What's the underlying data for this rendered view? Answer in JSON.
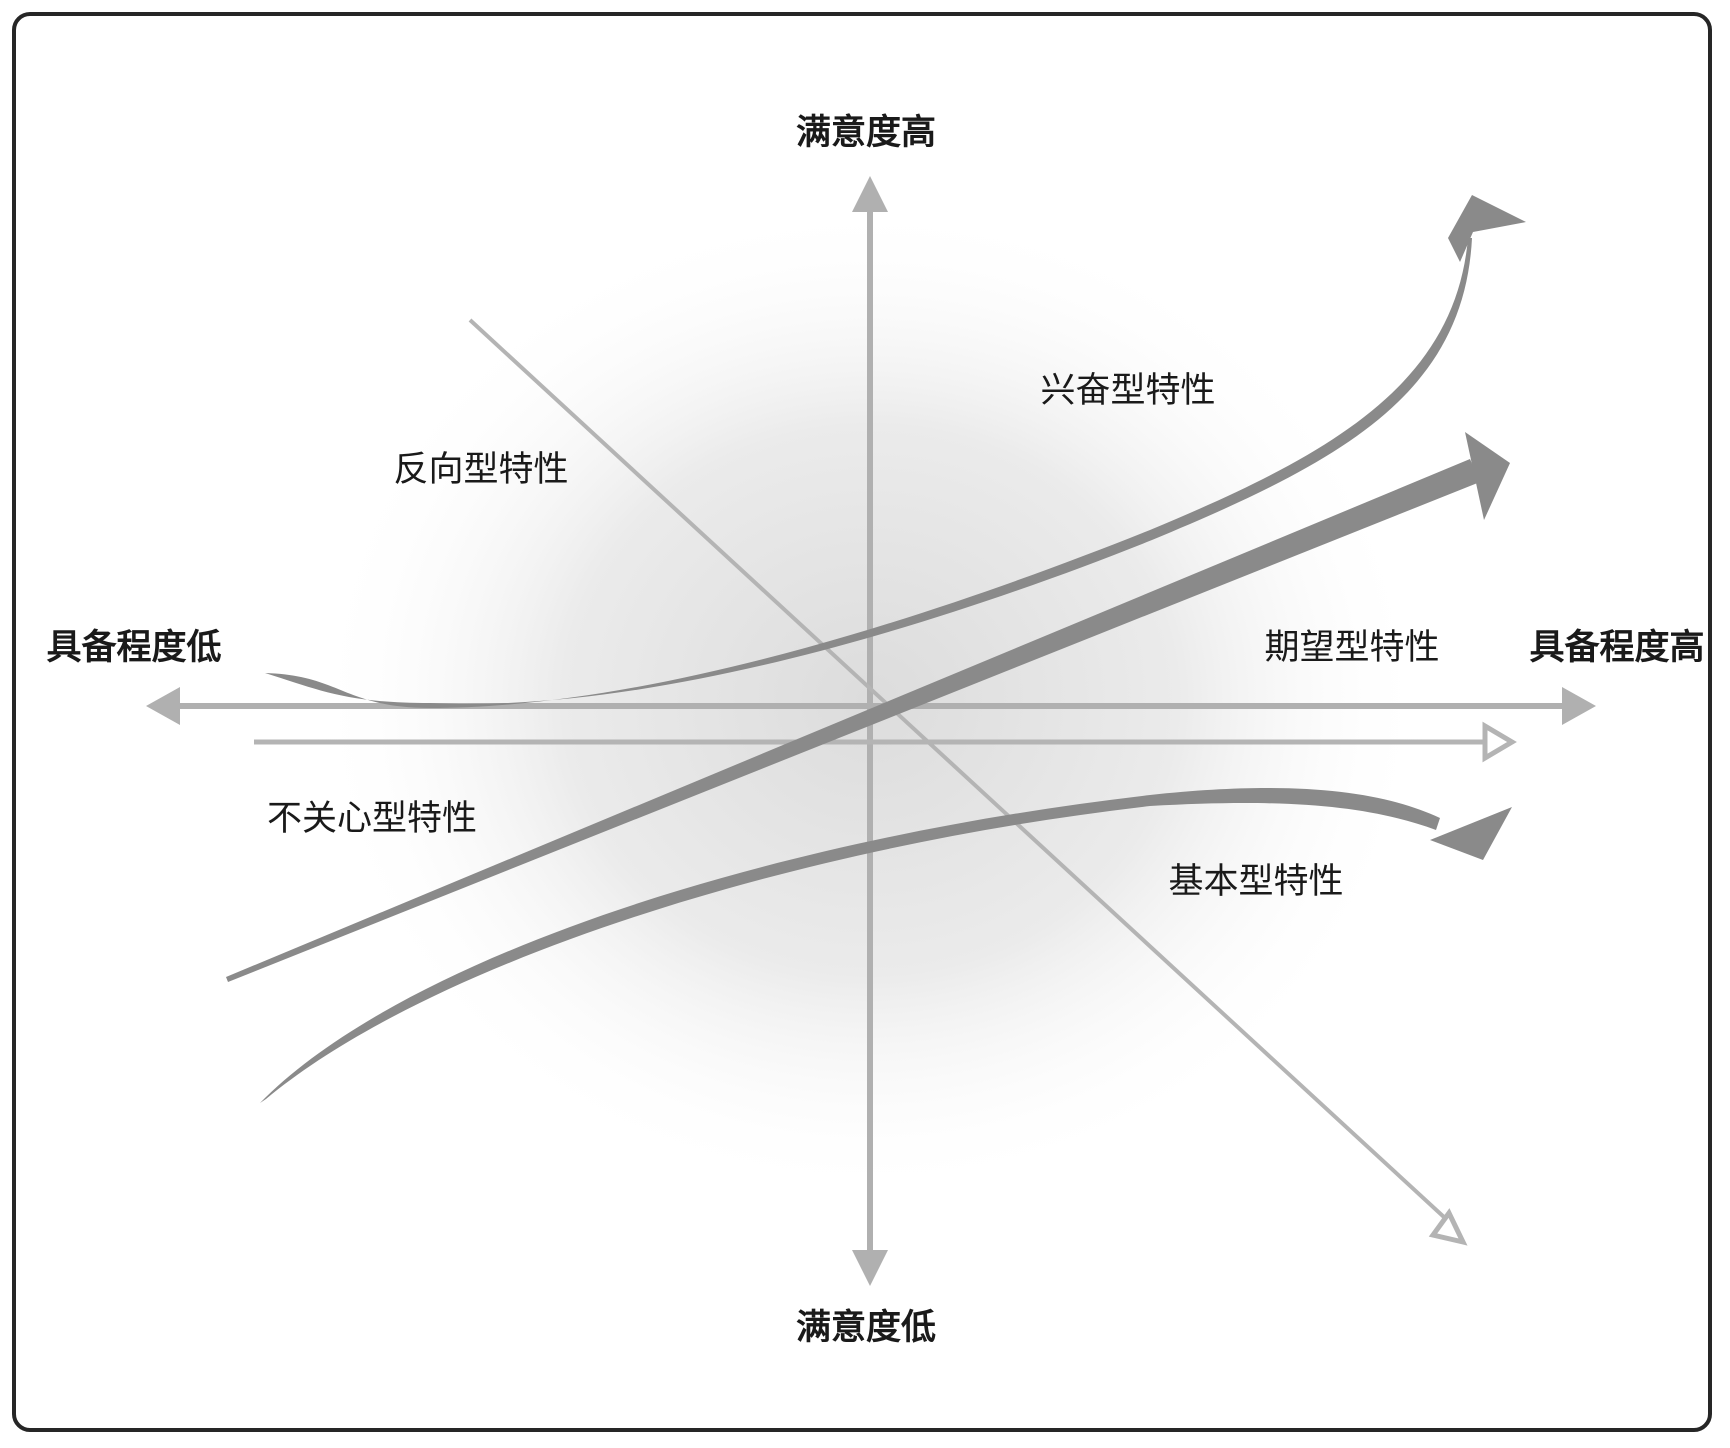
{
  "axes": {
    "satisfaction_high": "满意度高",
    "satisfaction_low": "满意度低",
    "fulfillment_low": "具备程度低",
    "fulfillment_high": "具备程度高"
  },
  "attributes": {
    "reverse": "反向型特性",
    "attractive": "兴奋型特性",
    "one_dimensional": "期望型特性",
    "indifferent": "不关心型特性",
    "must_be": "基本型特性"
  },
  "colors": {
    "frame": "#262626",
    "axis": "#b0b0b0",
    "curve": "#8a8a8a",
    "thin_line": "#b4b4b4",
    "text": "#1a1a1a"
  }
}
